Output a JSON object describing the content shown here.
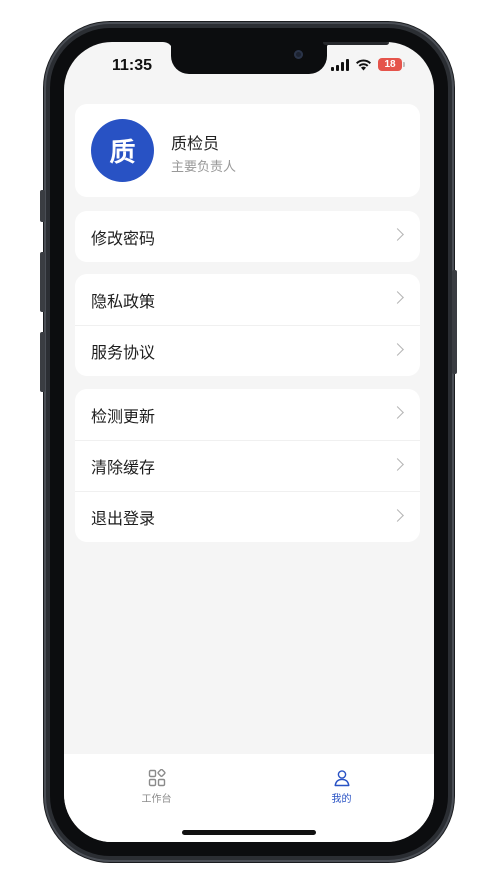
{
  "status_bar": {
    "time": "11:35",
    "battery": "18"
  },
  "profile": {
    "avatar_text": "质",
    "name": "质检员",
    "role": "主要负责人",
    "avatar_color": "#2852c4"
  },
  "menu_groups": [
    {
      "items": [
        {
          "label": "修改密码"
        }
      ]
    },
    {
      "items": [
        {
          "label": "隐私政策"
        },
        {
          "label": "服务协议"
        }
      ]
    },
    {
      "items": [
        {
          "label": "检测更新"
        },
        {
          "label": "清除缓存"
        },
        {
          "label": "退出登录"
        }
      ]
    }
  ],
  "tabbar": {
    "tabs": [
      {
        "label": "工作台",
        "icon": "grid-icon",
        "active": false
      },
      {
        "label": "我的",
        "icon": "user-icon",
        "active": true
      }
    ],
    "active_color": "#2852c4",
    "inactive_color": "#8a8a8a"
  }
}
